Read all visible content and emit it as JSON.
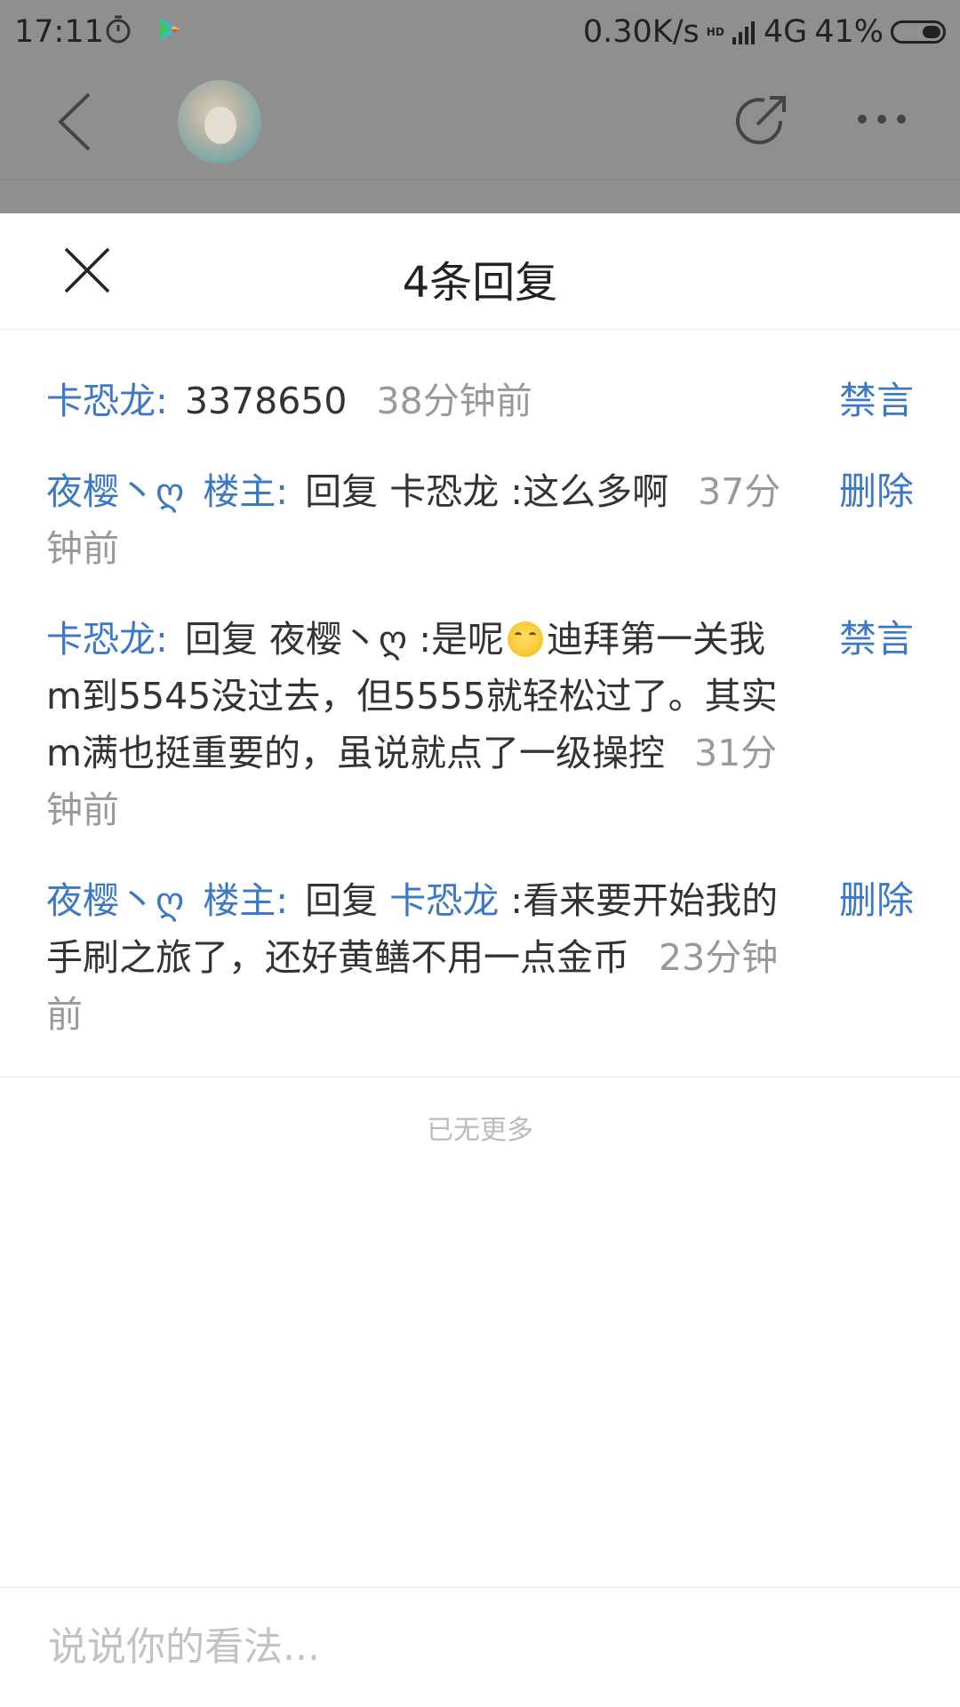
{
  "status_bar": {
    "time": "17:11",
    "network_speed": "0.30K/s",
    "hd_label": "HD",
    "network_type": "4G",
    "battery": "41%",
    "icons": [
      "stopwatch-icon",
      "play-store-icon",
      "signal-icon",
      "battery-icon"
    ]
  },
  "nav": {
    "icons": [
      "back-icon",
      "avatar",
      "share-icon",
      "more-icon"
    ]
  },
  "sheet": {
    "title": "4条回复",
    "close_icon": "close-icon",
    "replies": [
      {
        "user": "卡恐龙",
        "text": "3378650",
        "time": "38分钟前",
        "action": "禁言"
      },
      {
        "user": "夜樱丶ღ",
        "badge": "楼主",
        "reply_prefix": "回复",
        "reply_to": "卡恐龙",
        "text": ":这么多啊",
        "time": "37分钟前",
        "action": "删除"
      },
      {
        "user": "卡恐龙",
        "reply_prefix": "回复",
        "reply_to": "夜樱丶ღ",
        "text_before": ":是呢",
        "emoji": "smile-emoji-icon",
        "text_after": "迪拜第一关我m到5545没过去，但5555就轻松过了。其实m满也挺重要的，虽说就点了一级操控",
        "time": "31分钟前",
        "action": "禁言"
      },
      {
        "user": "夜樱丶ღ",
        "badge": "楼主",
        "reply_prefix": "回复",
        "reply_to": "卡恐龙",
        "text": ":看来要开始我的手刷之旅了，还好黄鳝不用一点金币",
        "time": "23分钟前",
        "action": "删除"
      }
    ],
    "no_more": "已无更多"
  },
  "input": {
    "placeholder": "说说你的看法..."
  },
  "colors": {
    "link_blue": "#3c78c3",
    "timestamp_gray": "#999999",
    "overlay_gray": "#8f8f8f"
  }
}
